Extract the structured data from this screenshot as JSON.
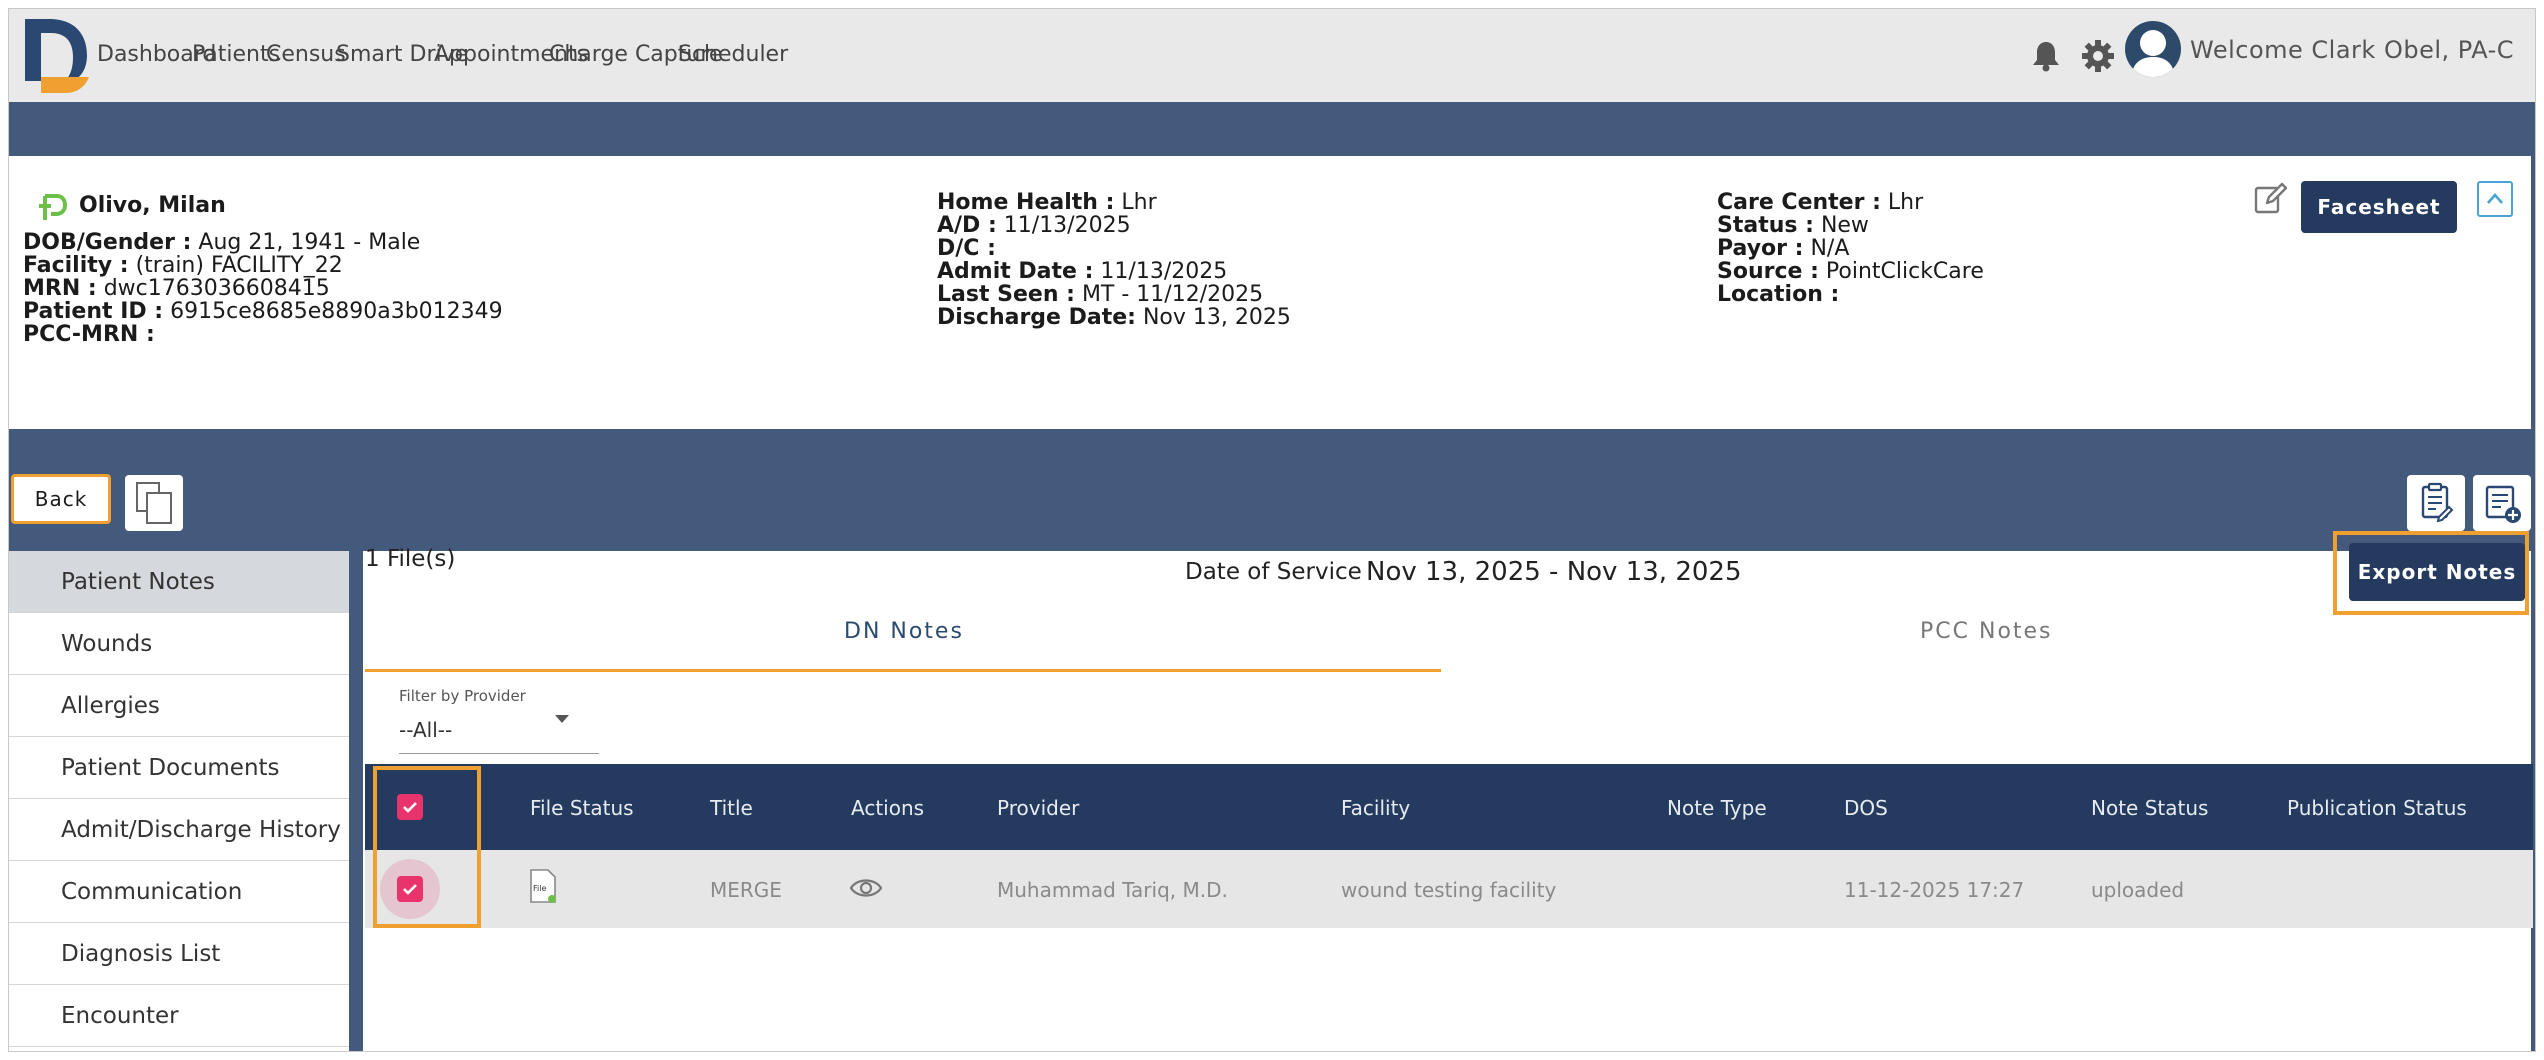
{
  "nav": {
    "items": [
      "Dashboard",
      "Patients",
      "Census",
      "Smart Drive",
      "Appointments",
      "Charge Capture",
      "Scheduler"
    ],
    "welcome": "Welcome Clark Obel, PA-C",
    "colors": {
      "accent": "#f0a030",
      "primary": "#243b5f",
      "band": "#445a7c"
    }
  },
  "patient": {
    "name": "Olivo, Milan",
    "col1": [
      {
        "label": "DOB/Gender :",
        "value": "Aug 21, 1941 - Male"
      },
      {
        "label": "Facility :",
        "value": "(train) FACILITY_22"
      },
      {
        "label": "MRN :",
        "value": "dwc1763036608415"
      },
      {
        "label": "Patient ID :",
        "value": "6915ce8685e8890a3b012349"
      },
      {
        "label": "PCC-MRN :",
        "value": ""
      }
    ],
    "col2": [
      {
        "label": "Home Health :",
        "value": "Lhr"
      },
      {
        "label": "A/D :",
        "value": "11/13/2025"
      },
      {
        "label": "D/C :",
        "value": ""
      },
      {
        "label": "Admit Date :",
        "value": "11/13/2025"
      },
      {
        "label": "Last Seen :",
        "value": "MT - 11/12/2025"
      },
      {
        "label": "Discharge Date:",
        "value": "Nov 13, 2025"
      }
    ],
    "col3": [
      {
        "label": "Care Center :",
        "value": "Lhr"
      },
      {
        "label": "Status :",
        "value": "New"
      },
      {
        "label": "Payor :",
        "value": "N/A"
      },
      {
        "label": "Source :",
        "value": "PointClickCare"
      },
      {
        "label": "Location :",
        "value": ""
      }
    ],
    "facesheet_label": "Facesheet"
  },
  "actions": {
    "back_label": "Back"
  },
  "sidebar": {
    "items": [
      "Patient Notes",
      "Wounds",
      "Allergies",
      "Patient Documents",
      "Admit/Discharge History",
      "Communication",
      "Diagnosis List",
      "Encounter"
    ],
    "active": "Patient Notes"
  },
  "main": {
    "files_count": "1 File(s)",
    "dos_label": "Date of Service",
    "dos_range": "Nov 13, 2025 - Nov 13, 2025",
    "export_label": "Export Notes",
    "tabs": [
      "DN Notes",
      "PCC Notes"
    ],
    "active_tab": "DN Notes",
    "filter": {
      "label": "Filter by Provider",
      "value": "--All--"
    }
  },
  "table": {
    "headers": [
      "File Status",
      "Title",
      "Actions",
      "Provider",
      "Facility",
      "Note Type",
      "DOS",
      "Note Status",
      "Publication Status"
    ],
    "rows": [
      {
        "file_icon_text": "File",
        "title": "MERGE",
        "provider": "Muhammad Tariq, M.D.",
        "facility": "wound testing facility",
        "note_type": "",
        "dos": "11-12-2025 17:27",
        "note_status": "uploaded",
        "publication_status": "",
        "checked": true
      }
    ],
    "select_all_checked": true
  }
}
